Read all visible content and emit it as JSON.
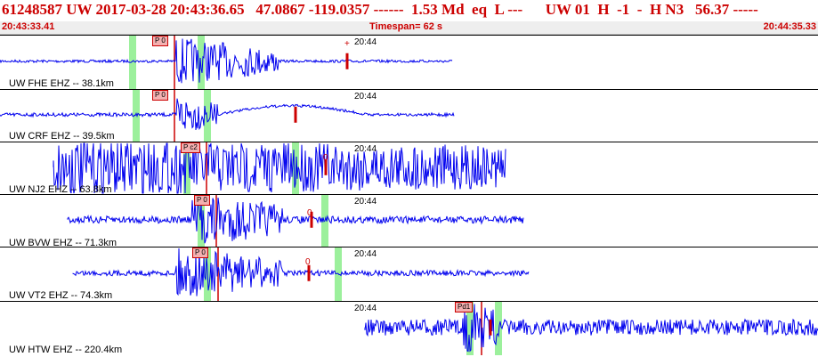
{
  "header": {
    "event_line": "61248587 UW 2017-03-28 20:43:36.65   47.0867 -119.0357 ------  1.53 Md  eq  L ---      UW 01  H  -1  -  H N3   56.37 -----",
    "start_time": "20:43:33.41",
    "timespan": "Timespan=  62 s",
    "end_time": "20:44:35.33"
  },
  "colors": {
    "trace": "#0000ee",
    "pick": "#cc0000",
    "window": "#9cf09c",
    "header_text": "#cc0000"
  },
  "panels": [
    {
      "label": "UW FHE EHZ -- 38.1km",
      "time_tick": "20:44",
      "pick_label": "P 0",
      "coda_label": "+"
    },
    {
      "label": "UW CRF EHZ -- 39.5km",
      "time_tick": "20:44",
      "pick_label": "P 0",
      "coda_label": ""
    },
    {
      "label": "UW NJ2 EHZ -- 63.8km",
      "time_tick": "20:44",
      "pick_label": "P c2",
      "coda_label": "0"
    },
    {
      "label": "UW BVW EHZ -- 71.3km",
      "time_tick": "20:44",
      "pick_label": "P 0",
      "coda_label": "0"
    },
    {
      "label": "UW VT2 EHZ -- 74.3km",
      "time_tick": "20:44",
      "pick_label": "P 0",
      "coda_label": "0"
    },
    {
      "label": "UW HTW EHZ -- 220.4km",
      "time_tick": "20:44",
      "pick_label": "Pd1",
      "coda_label": ""
    }
  ]
}
